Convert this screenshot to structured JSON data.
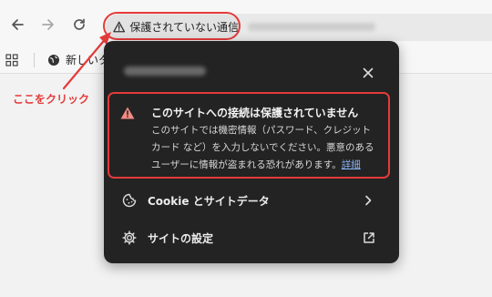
{
  "toolbar": {
    "security_chip_label": "保護されていない通信"
  },
  "bookmarks": {
    "item_label": "新しいタ"
  },
  "annotation": {
    "label": "ここをクリック",
    "color": "#e53b3b"
  },
  "panel": {
    "warning": {
      "title": "このサイトへの接続は保護されていません",
      "body": "このサイトでは機密情報（パスワード、クレジット カード など）を入力しないでください。悪意のあるユーザーに情報が盗まれる恐れがあります。",
      "link": "詳細"
    },
    "rows": [
      {
        "label": "Cookie とサイトデータ",
        "icon": "cookie-icon",
        "end_icon": "chevron-right-icon"
      },
      {
        "label": "サイトの設定",
        "icon": "gear-icon",
        "end_icon": "open-external-icon"
      }
    ]
  },
  "colors": {
    "highlight": "#e53b3b",
    "panel_bg": "#232323",
    "warning_icon": "#f28b82",
    "link": "#8ab4f8"
  }
}
